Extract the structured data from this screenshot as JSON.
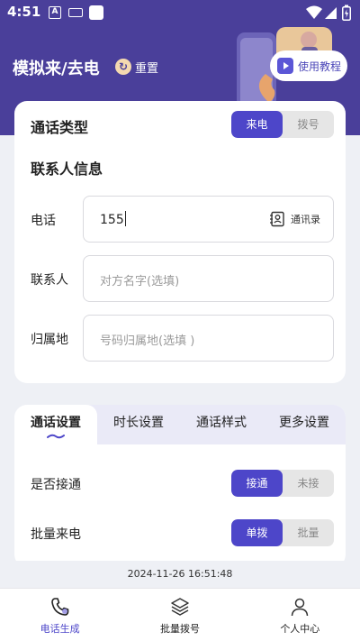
{
  "status_bar": {
    "time": "4:51",
    "a_icon": "A"
  },
  "header": {
    "title": "模拟来/去电",
    "reset_label": "重置",
    "guide_label": "使用教程",
    "accent": "#4a3f9a"
  },
  "call_type": {
    "title": "通话类型",
    "options": [
      "来电",
      "拨号"
    ],
    "selected": "来电"
  },
  "contact_info": {
    "title": "联系人信息",
    "phone": {
      "label": "电话",
      "value": "155",
      "contacts_label": "通讯录"
    },
    "name": {
      "label": "联系人",
      "placeholder": "对方名字(选填)"
    },
    "location": {
      "label": "归属地",
      "placeholder": "号码归属地(选填 )"
    }
  },
  "settings": {
    "tabs": [
      "通话设置",
      "时长设置",
      "通话样式",
      "更多设置"
    ],
    "active_tab": "通话设置",
    "answered": {
      "label": "是否接通",
      "options": [
        "接通",
        "未接"
      ],
      "selected": "接通"
    },
    "batch": {
      "label": "批量来电",
      "options": [
        "单拨",
        "批量"
      ],
      "selected": "单拨"
    }
  },
  "footer_time": "2024-11-26 16:51:48",
  "bottom_nav": {
    "items": [
      "电话生成",
      "批量拨号",
      "个人中心"
    ],
    "active": "电话生成"
  },
  "colors": {
    "primary": "#4d46c9",
    "inactive_segment": "#e6e6e6"
  }
}
